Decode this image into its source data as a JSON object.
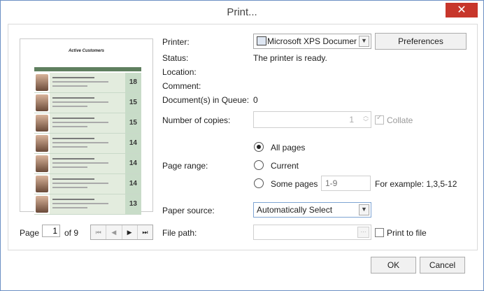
{
  "window": {
    "title": "Print...",
    "close_glyph": "✕"
  },
  "preview": {
    "title": "Active Customers",
    "rows": [
      {
        "num": "18"
      },
      {
        "num": "15"
      },
      {
        "num": "15"
      },
      {
        "num": "14"
      },
      {
        "num": "14"
      },
      {
        "num": "14"
      },
      {
        "num": "13"
      }
    ]
  },
  "pager": {
    "page_label": "Page",
    "page_value": "1",
    "of_label": "of 9",
    "first": "⏮",
    "prev": "◀",
    "next": "▶",
    "last": "⏭"
  },
  "fields": {
    "printer_label": "Printer:",
    "printer_value": "Microsoft XPS Documer",
    "preferences_label": "Preferences",
    "status_label": "Status:",
    "status_value": "The printer is ready.",
    "location_label": "Location:",
    "comment_label": "Comment:",
    "queue_label": "Document(s) in Queue:",
    "queue_value": "0",
    "copies_label": "Number of copies:",
    "copies_value": "1",
    "collate_label": "Collate",
    "range_label": "Page range:",
    "all_pages": "All pages",
    "current": "Current",
    "some_pages": "Some pages",
    "some_pages_placeholder": "1-9",
    "example": "For example: 1,3,5-12",
    "paper_source_label": "Paper source:",
    "paper_source_value": "Automatically Select",
    "file_path_label": "File path:",
    "browse_glyph": "···",
    "print_to_file": "Print to file"
  },
  "buttons": {
    "ok": "OK",
    "cancel": "Cancel"
  }
}
